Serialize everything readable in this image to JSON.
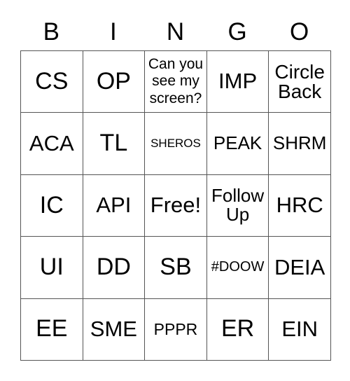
{
  "card": {
    "headers": [
      "B",
      "I",
      "N",
      "G",
      "O"
    ],
    "rows": [
      [
        {
          "text": "CS",
          "size": "fs-xxl"
        },
        {
          "text": "OP",
          "size": "fs-xxl"
        },
        {
          "text": "Can you see my screen?",
          "size": "fs-xs"
        },
        {
          "text": "IMP",
          "size": "fs-xl"
        },
        {
          "text": "Circle Back",
          "size": "fs-lg"
        }
      ],
      [
        {
          "text": "ACA",
          "size": "fs-xl"
        },
        {
          "text": "TL",
          "size": "fs-xxl"
        },
        {
          "text": "SHEROS",
          "size": "fs-tiny"
        },
        {
          "text": "PEAK",
          "size": "fs-md"
        },
        {
          "text": "SHRM",
          "size": "fs-md"
        }
      ],
      [
        {
          "text": "IC",
          "size": "fs-xxl"
        },
        {
          "text": "API",
          "size": "fs-xl"
        },
        {
          "text": "Free!",
          "size": "fs-xl"
        },
        {
          "text": "Follow Up",
          "size": "fs-md"
        },
        {
          "text": "HRC",
          "size": "fs-xl"
        }
      ],
      [
        {
          "text": "UI",
          "size": "fs-xxl"
        },
        {
          "text": "DD",
          "size": "fs-xxl"
        },
        {
          "text": "SB",
          "size": "fs-xxl"
        },
        {
          "text": "#DOOW",
          "size": "fs-xxs"
        },
        {
          "text": "DEIA",
          "size": "fs-xl"
        }
      ],
      [
        {
          "text": "EE",
          "size": "fs-xxl"
        },
        {
          "text": "SME",
          "size": "fs-xl"
        },
        {
          "text": "PPPR",
          "size": "fs-sm"
        },
        {
          "text": "ER",
          "size": "fs-xxl"
        },
        {
          "text": "EIN",
          "size": "fs-xl"
        }
      ]
    ]
  },
  "colors": {
    "border": "#555555",
    "text": "#000000",
    "cell_background": "#ffffff",
    "page_background": "#ffffff"
  }
}
